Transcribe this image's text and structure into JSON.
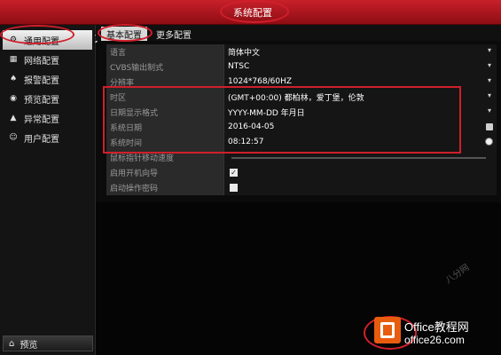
{
  "window": {
    "title": "系统配置"
  },
  "sidebar": {
    "items": [
      {
        "label": "通用配置",
        "icon": "settings-icon",
        "active": true
      },
      {
        "label": "网络配置",
        "icon": "network-icon",
        "active": false
      },
      {
        "label": "报警配置",
        "icon": "alarm-icon",
        "active": false
      },
      {
        "label": "预览配置",
        "icon": "preview-icon",
        "active": false
      },
      {
        "label": "异常配置",
        "icon": "warning-icon",
        "active": false
      },
      {
        "label": "用户配置",
        "icon": "users-icon",
        "active": false
      }
    ],
    "bottom": {
      "label": "预览",
      "icon": "home-icon"
    }
  },
  "tabs": {
    "active": "基本配置",
    "other": "更多配置"
  },
  "settings": {
    "rows": [
      {
        "label": "语言",
        "value": "简体中文",
        "control": "dropdown"
      },
      {
        "label": "CVBS输出制式",
        "value": "NTSC",
        "control": "dropdown"
      },
      {
        "label": "分辨率",
        "value": "1024*768/60HZ",
        "control": "dropdown"
      },
      {
        "label": "时区",
        "value": "(GMT+00:00) 都柏林，爱丁堡，伦敦",
        "control": "dropdown"
      },
      {
        "label": "日期显示格式",
        "value": "YYYY-MM-DD 年月日",
        "control": "dropdown"
      },
      {
        "label": "系统日期",
        "value": "2016-04-05",
        "control": "calendar"
      },
      {
        "label": "系统时间",
        "value": "08:12:57",
        "control": "clock"
      },
      {
        "label": "鼠标指针移动速度",
        "value": "",
        "control": "slider"
      },
      {
        "label": "启用开机向导",
        "value": "✓",
        "control": "checkbox-checked"
      },
      {
        "label": "启动操作密码",
        "value": "",
        "control": "checkbox-unchecked"
      }
    ]
  },
  "watermark": {
    "brand": "Office教程网",
    "site": "office26.com",
    "side": "八分网"
  },
  "colors": {
    "titlebar": "#b0151d",
    "annotation": "#d01f2b",
    "logo": "#e85c0f"
  }
}
